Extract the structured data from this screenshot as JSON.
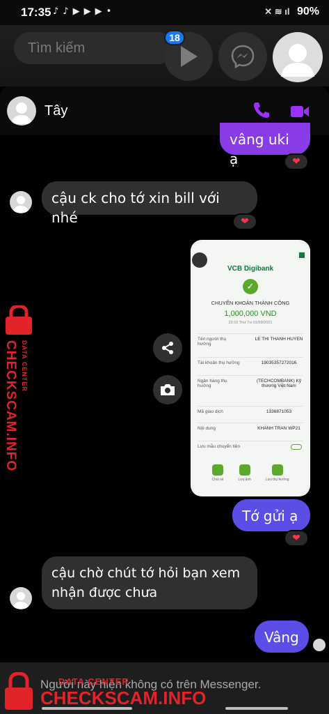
{
  "status_bar": {
    "time": "17:35",
    "battery": "90%"
  },
  "top_bar": {
    "search_placeholder": "Tìm kiếm",
    "badge_count": "18"
  },
  "conversation": {
    "contact_name": "Tây"
  },
  "messages": [
    {
      "text": "vâng uki ạ",
      "direction": "out"
    },
    {
      "text": "cậu ck cho tớ xin bill với nhé",
      "direction": "in"
    },
    {
      "text": "Tớ gửi ạ",
      "direction": "out"
    },
    {
      "text_line1": "cậu chờ chút tớ hỏi bạn xem",
      "text_line2": "nhận được chưa",
      "direction": "in"
    },
    {
      "text": "Vâng",
      "direction": "out"
    }
  ],
  "receipt": {
    "bank_logo": "VCB Digibank",
    "title": "CHUYỂN KHOẢN THÀNH CÔNG",
    "amount": "1,000,000 VND",
    "datetime": "23:10 Thứ Tư 01/09/2021",
    "rows": [
      {
        "label": "Tên người thụ hưởng",
        "value": "LE THI THANH HUYEN"
      },
      {
        "label": "Tài khoản thụ hưởng",
        "value": "19035357272016"
      },
      {
        "label": "Ngân hàng thụ hưởng",
        "value": "(TECHCOMBANK) Kỹ thương Việt Nam"
      },
      {
        "label": "Mã giao dịch",
        "value": "1336871053"
      },
      {
        "label": "Nội dung",
        "value": "KHANH TRAN WP21"
      },
      {
        "label": "Lưu mẫu chuyển tiền",
        "value": ""
      }
    ],
    "actions": [
      "Chia sẻ",
      "Lưu ảnh",
      "Lưu thụ hưởng"
    ]
  },
  "bottom_bar": {
    "notice": "Người này hiện không có trên Messenger."
  },
  "watermark": {
    "brand": "CHECKSCAM.INFO",
    "tagline": "DATA CENTER"
  },
  "colors": {
    "accent": "#5a4ee6",
    "call_icons": "#9b30ff",
    "watermark": "#e0242a"
  }
}
